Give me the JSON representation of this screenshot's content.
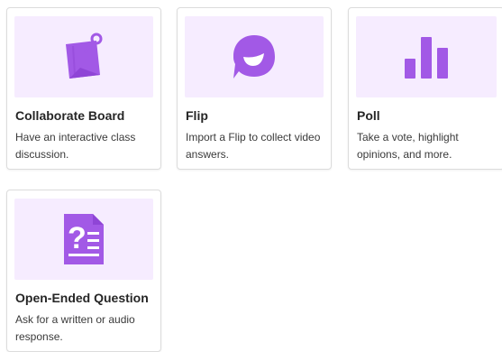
{
  "colors": {
    "thumb_bg": "#f6ecff",
    "icon": "#a259e6",
    "icon_dark": "#8f45d6"
  },
  "cards": [
    {
      "icon": "sticky-note-pin-icon",
      "title": "Collaborate Board",
      "description": "Have an interactive class discussion."
    },
    {
      "icon": "flip-smile-icon",
      "title": "Flip",
      "description": "Import a Flip to collect video answers."
    },
    {
      "icon": "bar-chart-icon",
      "title": "Poll",
      "description": "Take a vote, highlight opinions, and more."
    },
    {
      "icon": "question-document-icon",
      "title": "Open-Ended Question",
      "description": "Ask for a written or audio response."
    }
  ]
}
